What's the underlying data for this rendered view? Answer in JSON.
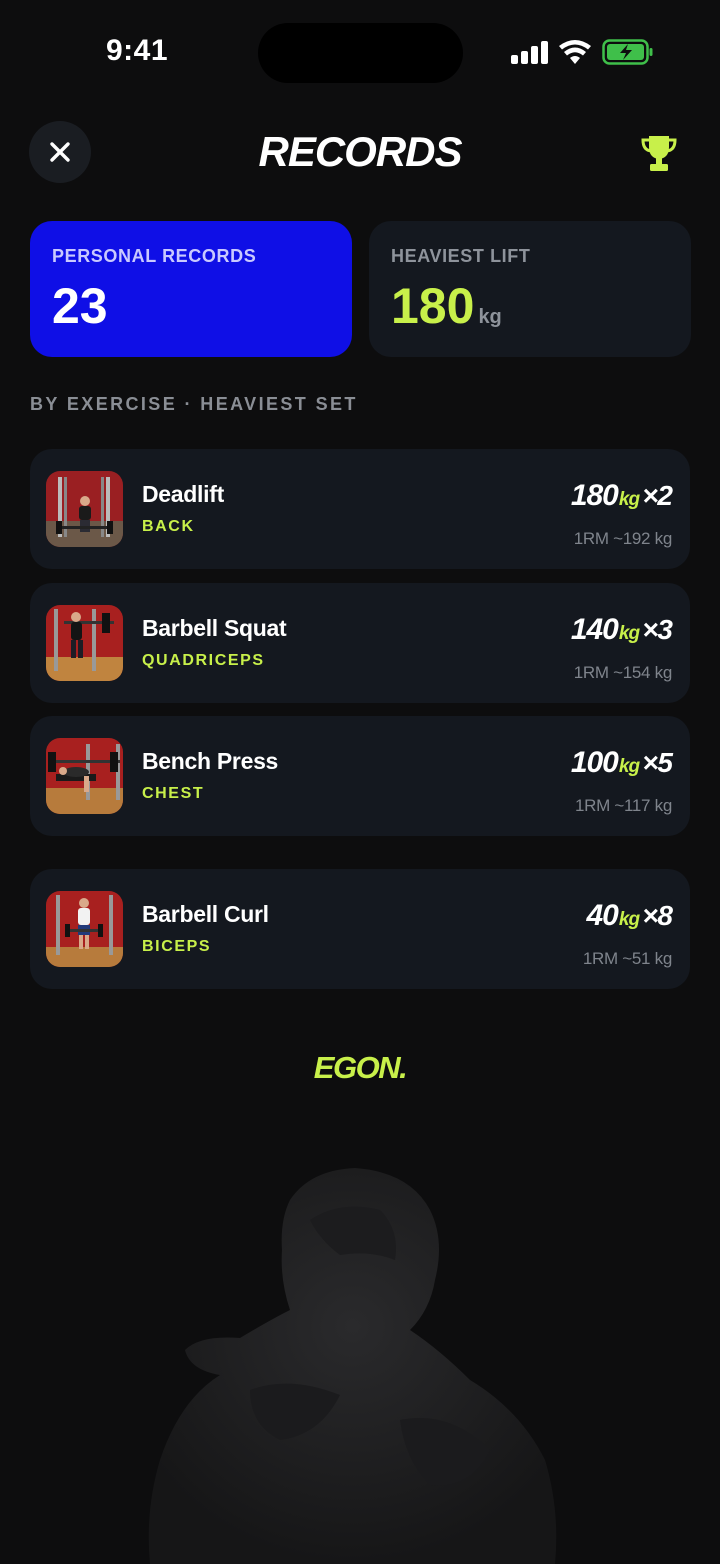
{
  "status_bar": {
    "time": "9:41"
  },
  "header": {
    "title": "RECORDS",
    "close_icon": "close-icon",
    "trophy_icon": "trophy-icon"
  },
  "stats": {
    "personal_records": {
      "label": "PERSONAL RECORDS",
      "value": "23"
    },
    "heaviest_lift": {
      "label": "HEAVIEST LIFT",
      "value": "180",
      "unit": "kg"
    }
  },
  "section_label": "BY EXERCISE · HEAVIEST SET",
  "exercises": [
    {
      "name": "Deadlift",
      "muscle": "BACK",
      "weight": "180",
      "unit": "kg",
      "reps": "×2",
      "one_rm": "1RM ~192 kg"
    },
    {
      "name": "Barbell Squat",
      "muscle": "QUADRICEPS",
      "weight": "140",
      "unit": "kg",
      "reps": "×3",
      "one_rm": "1RM ~154 kg"
    },
    {
      "name": "Bench Press",
      "muscle": "CHEST",
      "weight": "100",
      "unit": "kg",
      "reps": "×5",
      "one_rm": "1RM ~117 kg"
    },
    {
      "name": "Barbell Curl",
      "muscle": "BICEPS",
      "weight": "40",
      "unit": "kg",
      "reps": "×8",
      "one_rm": "1RM ~51 kg"
    }
  ],
  "brand": "EGON.",
  "colors": {
    "accent": "#c8f04a",
    "primary_blue": "#0f0fe6",
    "card": "#14181f",
    "background": "#0d0d0e"
  }
}
